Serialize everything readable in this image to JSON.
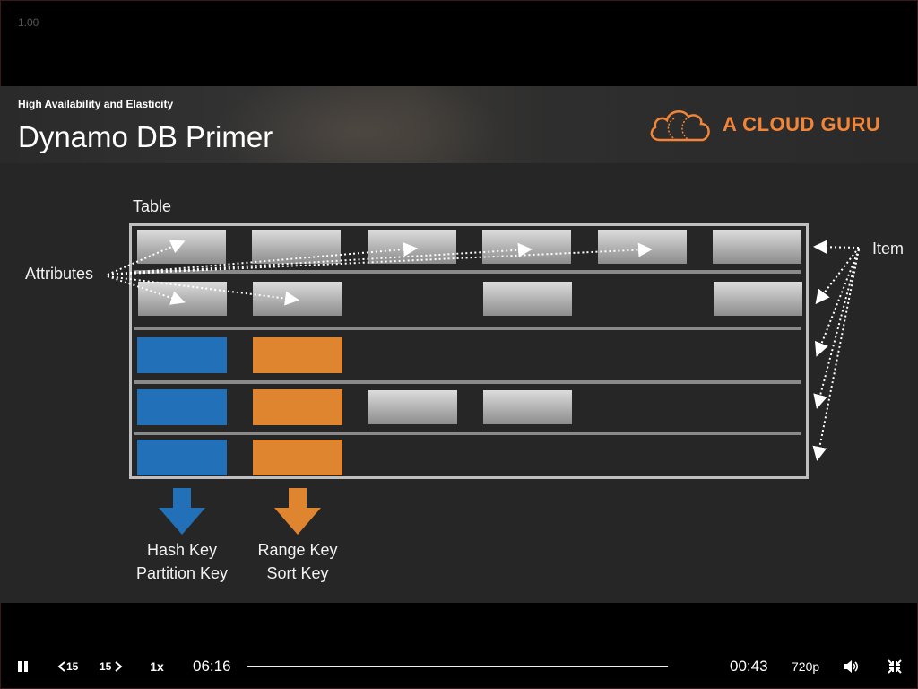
{
  "player": {
    "playback_rate_overlay": "1.00",
    "speed_label": "1x",
    "skip_back_label": "15",
    "skip_forward_label": "15",
    "elapsed_time": "06:16",
    "remaining_time": "00:43",
    "quality_label": "720p"
  },
  "slide": {
    "section_title": "High Availability and Elasticity",
    "title": "Dynamo DB Primer",
    "brand_name": "A CLOUD GURU",
    "brand_color": "#f58536",
    "table_label": "Table",
    "attributes_label": "Attributes",
    "item_label": "Item",
    "hash_key_line1": "Hash Key",
    "hash_key_line2": "Partition Key",
    "range_key_line1": "Range Key",
    "range_key_line2": "Sort Key",
    "hash_color": "#2170b8",
    "range_color": "#df8530"
  },
  "icons": [
    "pause-icon",
    "skip-back-icon",
    "skip-forward-icon",
    "volume-icon",
    "exit-fullscreen-icon",
    "cloud-logo-icon"
  ]
}
